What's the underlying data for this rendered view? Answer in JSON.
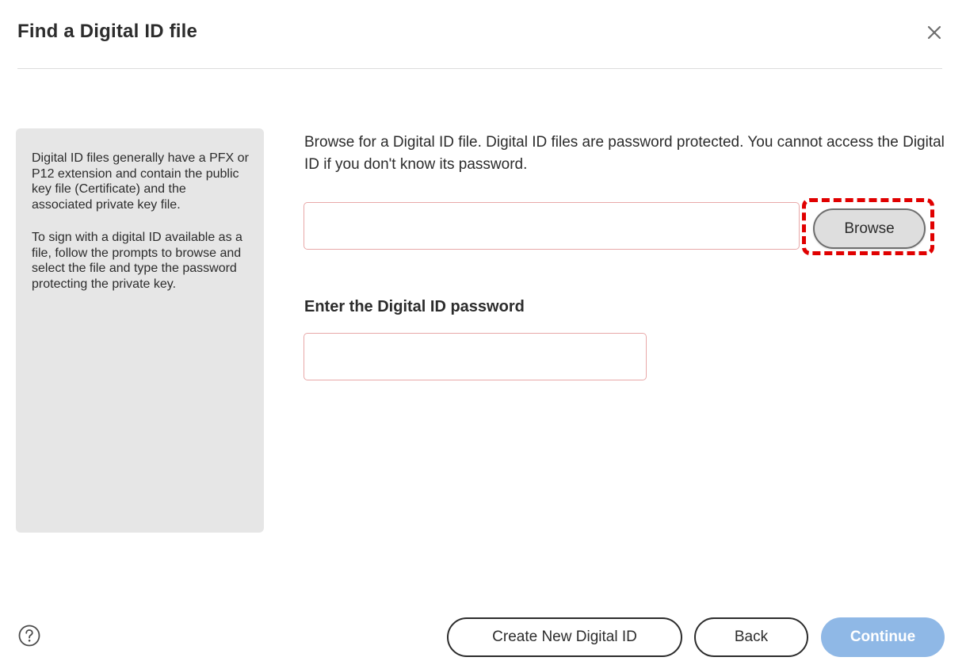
{
  "dialog": {
    "title": "Find a Digital ID file",
    "close_icon": "close-icon"
  },
  "info_panel": {
    "paragraph1": "Digital ID files generally have a PFX or P12 extension and contain the public key file (Certificate) and the associated private key file.",
    "paragraph2": "To sign with a digital ID available as a file, follow the prompts to browse and select the file and type the password protecting the private key."
  },
  "main": {
    "instruction": "Browse for a Digital ID file. Digital ID files are password protected. You cannot access the Digital ID if you don't know its password.",
    "file_path_value": "",
    "browse_label": "Browse",
    "password_label": "Enter the Digital ID password",
    "password_value": ""
  },
  "footer": {
    "help_icon": "help-icon",
    "create_label": "Create New Digital ID",
    "back_label": "Back",
    "continue_label": "Continue",
    "continue_enabled": false
  },
  "colors": {
    "highlight": "#e00000",
    "continue_disabled": "#8fb8e6",
    "input_border": "#e8a8a8",
    "info_panel_bg": "#e6e6e6"
  }
}
